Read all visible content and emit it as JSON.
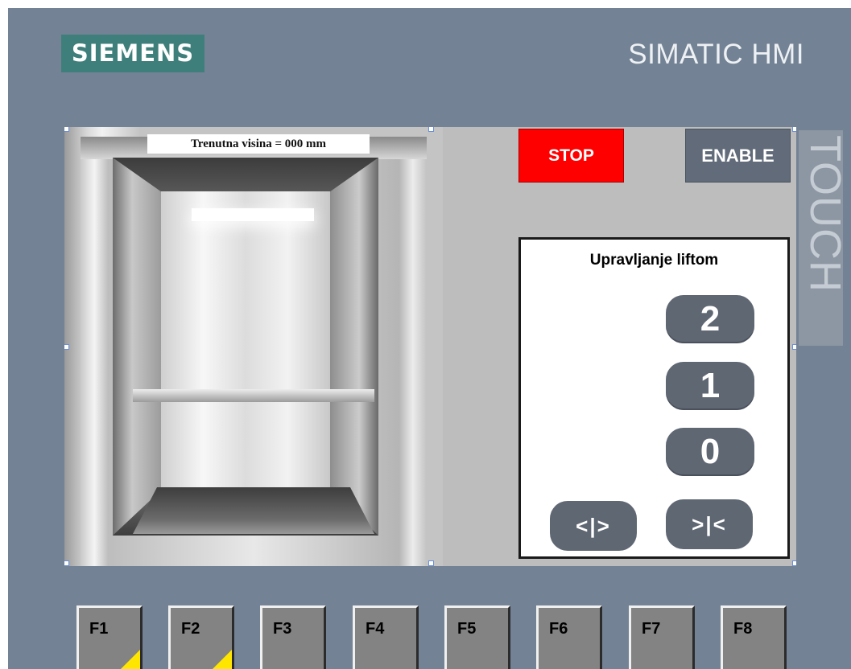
{
  "header": {
    "brand": "SIEMENS",
    "product": "SIMATIC HMI",
    "bezel_label": "TOUCH"
  },
  "elevator_view": {
    "height_readout": "Trenutna visina = 000 mm"
  },
  "buttons": {
    "stop_label": "STOP",
    "enable_label": "ENABLE"
  },
  "control": {
    "title": "Upravljanje liftom",
    "floors": [
      "2",
      "1",
      "0"
    ],
    "open_doors_label": "<|>",
    "close_doors_label": ">|<"
  },
  "function_keys": [
    {
      "label": "F1",
      "indicator": true
    },
    {
      "label": "F2",
      "indicator": true
    },
    {
      "label": "F3",
      "indicator": false
    },
    {
      "label": "F4",
      "indicator": false
    },
    {
      "label": "F5",
      "indicator": false
    },
    {
      "label": "F6",
      "indicator": false
    },
    {
      "label": "F7",
      "indicator": false
    },
    {
      "label": "F8",
      "indicator": false
    }
  ],
  "colors": {
    "bezel": "#738294",
    "brand_bg": "#3f7f7b",
    "stop_bg": "#ff0000",
    "button_bg": "#5f6773",
    "key_indicator": "#ffe600"
  }
}
